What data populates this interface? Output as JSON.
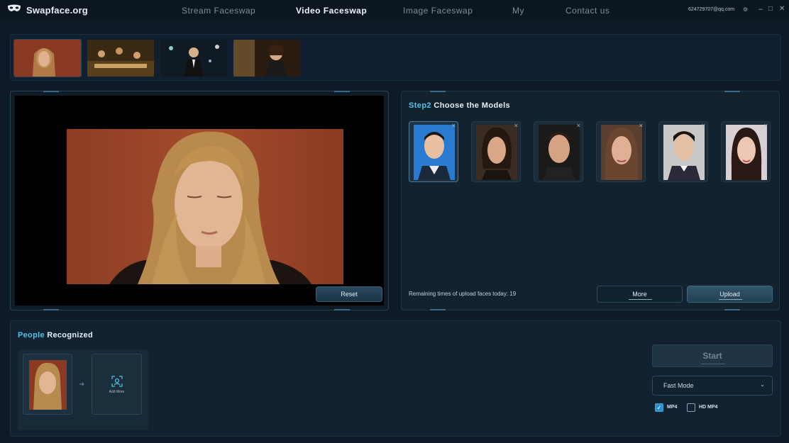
{
  "app": {
    "name": "Swapface.org"
  },
  "nav": [
    {
      "label": "Stream  Faceswap"
    },
    {
      "label": "Video  Faceswap"
    },
    {
      "label": "Image  Faceswap"
    },
    {
      "label": "My"
    },
    {
      "label": "Contact  us"
    }
  ],
  "account": {
    "email": "624729707@qq.com"
  },
  "window_controls": {
    "minimize": "–",
    "maximize": "□",
    "close": "✕"
  },
  "step2": {
    "title_highlight": "Step2",
    "title_rest": " Choose  the  Models",
    "remaining_text": "Remaining times of upload faces today: 19",
    "more_label": "More",
    "upload_label": "Upload"
  },
  "preview": {
    "reset_label": "Reset"
  },
  "people": {
    "title_highlight": "People",
    "title_rest": " Recognized",
    "add_more_label": "Add More"
  },
  "controls": {
    "start_label": "Start",
    "mode_value": "Fast Mode",
    "mp4_label": "MP4",
    "mp4_checked": true,
    "hd_mp4_label": "HD  MP4",
    "hd_mp4_checked": false
  },
  "colors": {
    "accent": "#4fc3e8",
    "background": "#0e1b26",
    "panel": "#12232f"
  }
}
